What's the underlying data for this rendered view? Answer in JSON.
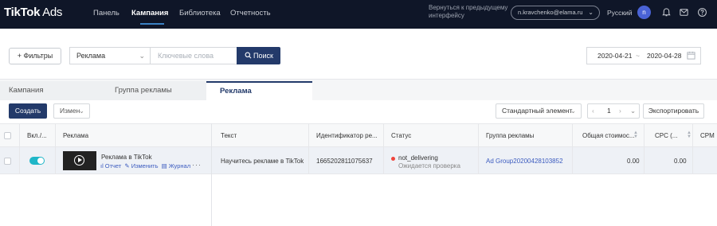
{
  "header": {
    "logo_brand": "TikTok",
    "logo_product": "Ads",
    "nav": [
      "Панель",
      "Кампания",
      "Библиотека",
      "Отчетность"
    ],
    "active_nav": "Кампания",
    "back_link": "Вернуться к предыдущему интерфейсу",
    "email": "n.kravchenko@elama.ru",
    "language": "Русский",
    "avatar_initial": "n",
    "icons": [
      "bell-icon",
      "message-icon",
      "help-icon"
    ]
  },
  "toolbar": {
    "filters_label": "+ Фильтры",
    "scope_select": "Реклама",
    "search_placeholder": "Ключевые слова",
    "search_label": "Поиск",
    "date_from": "2020-04-21",
    "date_sep": "~",
    "date_to": "2020-04-28"
  },
  "tabs": [
    "Кампания",
    "Группа рекламы",
    "Реклама"
  ],
  "active_tab": "Реклама",
  "actions": {
    "create_label": "Создать",
    "edit_label": "Измен",
    "view_select": "Стандартный элемент",
    "page": "1",
    "export_label": "Экспортировать"
  },
  "table": {
    "columns": [
      "Вкл./...",
      "Реклама",
      "Текст",
      "Идентификатор ре...",
      "Статус",
      "Группа рекламы",
      "Общая стоимос...",
      "CPC (...",
      "CPM"
    ],
    "rows": [
      {
        "enabled": true,
        "ad_name": "Реклама в TikTok",
        "ad_actions": [
          "Отчет",
          "Изменить",
          "Журнал"
        ],
        "more": "···",
        "text": "Научитесь рекламе в TikTok",
        "ad_id": "1665202811075637",
        "status": "not_delivering",
        "status_sub": "Ожидается проверка",
        "ad_group": "Ad Group20200428103852",
        "total_cost": "0.00",
        "cpc": "0.00",
        "cpm": ""
      }
    ]
  },
  "colors": {
    "topbar": "#0f1628",
    "primary": "#233a6a",
    "link": "#3b5bbf",
    "toggle_on": "#1fb6c8",
    "status_red": "#f0443c"
  }
}
